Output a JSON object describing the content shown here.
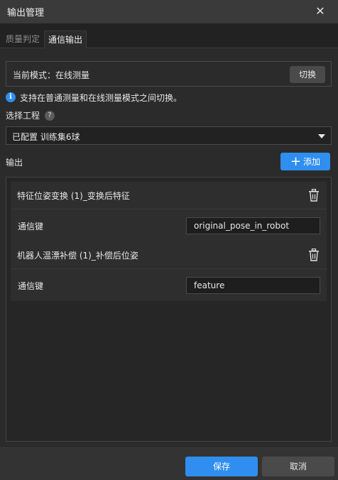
{
  "window": {
    "title": "输出管理",
    "close_icon": "close-icon"
  },
  "tabs": [
    {
      "label": "质量判定",
      "active": false
    },
    {
      "label": "通信输出",
      "active": true
    }
  ],
  "mode": {
    "text": "当前模式：在线测量",
    "switch_label": "切换"
  },
  "info": {
    "icon": "info-icon",
    "text": "支持在普通测量和在线测量模式之间切换。"
  },
  "project": {
    "label": "选择工程",
    "help_icon": "question-icon",
    "selected": "已配置 训练集6球"
  },
  "output": {
    "label": "输出",
    "add_label": "添加",
    "items": [
      {
        "name": "特征位姿变换 (1)_变换后特征",
        "key_label": "通信键",
        "key_value": "original_pose_in_robot"
      },
      {
        "name": "机器人温漂补偿 (1)_补偿后位姿",
        "key_label": "通信键",
        "key_value": "feature"
      }
    ]
  },
  "footer": {
    "save_label": "保存",
    "cancel_label": "取消"
  },
  "colors": {
    "accent": "#2f8ef0",
    "background": "#2b2b2b",
    "titlebar": "#3a3a3a"
  }
}
